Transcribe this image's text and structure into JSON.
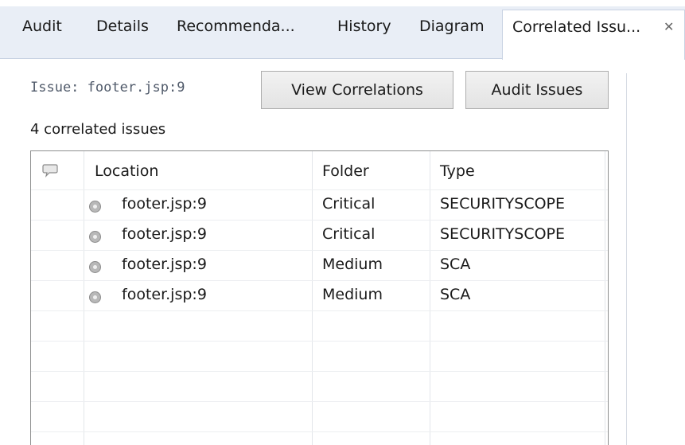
{
  "tabs": [
    {
      "label": "Audit"
    },
    {
      "label": "Details"
    },
    {
      "label": "Recommenda..."
    },
    {
      "label": "History"
    },
    {
      "label": "Diagram"
    },
    {
      "label": "Correlated Issu...",
      "active": true
    }
  ],
  "issue_label": "Issue: footer.jsp:9",
  "buttons": {
    "view_correlations": "View Correlations",
    "audit_issues": "Audit Issues"
  },
  "correlated_count": "4 correlated issues",
  "table": {
    "headers": {
      "comment_icon": "comment-icon",
      "location": "Location",
      "folder": "Folder",
      "type": "Type"
    },
    "rows": [
      {
        "location": "footer.jsp:9",
        "folder": "Critical",
        "type": "SECURITYSCOPE"
      },
      {
        "location": "footer.jsp:9",
        "folder": "Critical",
        "type": "SECURITYSCOPE"
      },
      {
        "location": "footer.jsp:9",
        "folder": "Medium",
        "type": "SCA"
      },
      {
        "location": "footer.jsp:9",
        "folder": "Medium",
        "type": "SCA"
      }
    ]
  },
  "colors": {
    "tab_strip": "#e9eef6",
    "button_border": "#adadad",
    "table_border": "#8e8f8f"
  }
}
